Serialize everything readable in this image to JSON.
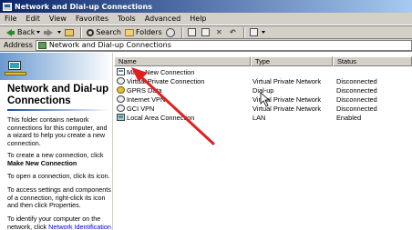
{
  "window": {
    "title": "Network and Dial-up Connections"
  },
  "menu": [
    "File",
    "Edit",
    "View",
    "Favorites",
    "Tools",
    "Advanced",
    "Help"
  ],
  "toolbar": {
    "back_label": "Back",
    "search_label": "Search",
    "folders_label": "Folders"
  },
  "address": {
    "label": "Address",
    "value": "Network and Dial-up Connections"
  },
  "left_pane": {
    "title_line1": "Network and Dial-up",
    "title_line2": "Connections",
    "p1": "This folder contains network connections for this computer, and a wizard to help you create a new connection.",
    "p2_text": "To create a new connection, click",
    "p2_bold": "Make New Connection",
    "p3": "To open a connection, click its icon.",
    "p4": "To access settings and components of a connection, right-click its icon and then click Properties.",
    "p5_text": "To identify your computer on the network, click",
    "p5_link": "Network Identification"
  },
  "columns": {
    "name": "Name",
    "type": "Type",
    "status": "Status"
  },
  "rows": [
    {
      "name": "Make New Connection",
      "type": "",
      "status": "",
      "icon": "wizard-icon"
    },
    {
      "name": "Virtual Private Connection",
      "type": "Virtual Private Network",
      "status": "Disconnected",
      "icon": "vpn-icon"
    },
    {
      "name": "GPRS Data",
      "type": "Dial-up",
      "status": "Disconnected",
      "icon": "dialup-icon"
    },
    {
      "name": "Internet VPN",
      "type": "Virtual Private Network",
      "status": "Disconnected",
      "icon": "vpn-icon"
    },
    {
      "name": "GCI VPN",
      "type": "Virtual Private Network",
      "status": "Disconnected",
      "icon": "vpn-icon"
    },
    {
      "name": "Local Area Connection",
      "type": "LAN",
      "status": "Enabled",
      "icon": "lan-icon"
    }
  ],
  "colors": {
    "title_bar": "#0a246a",
    "chrome": "#d4d0c8",
    "link": "#0000cc",
    "annotation_arrow": "#e02020"
  }
}
